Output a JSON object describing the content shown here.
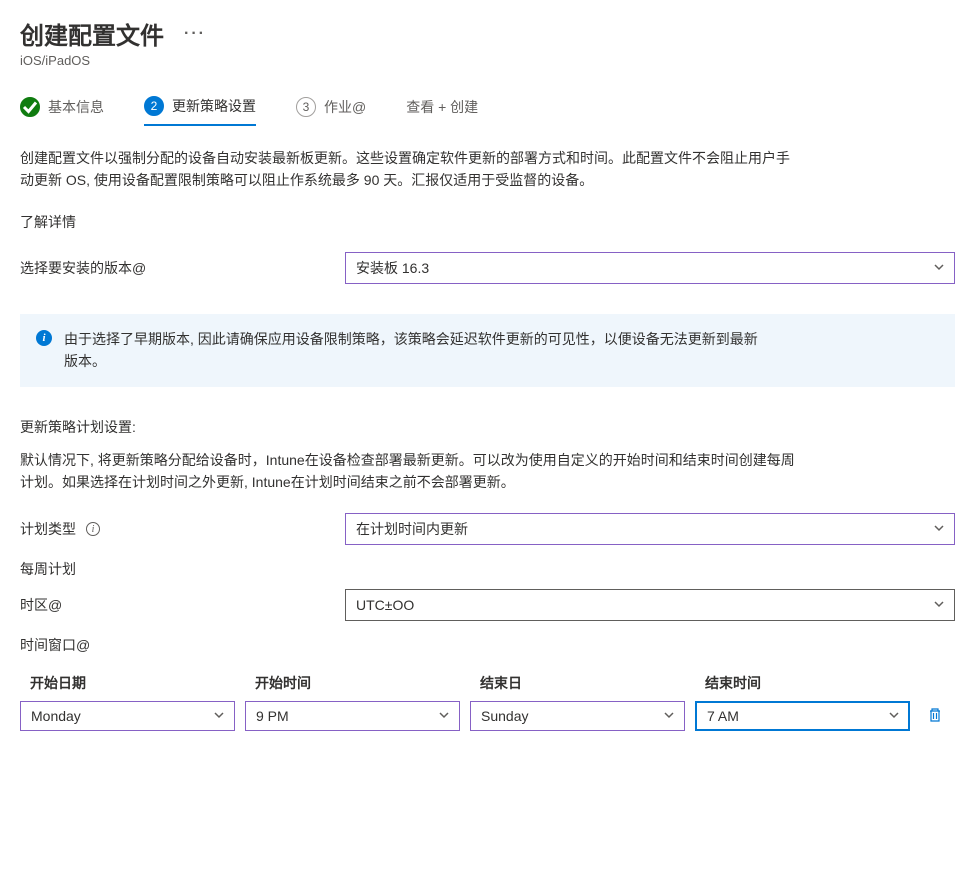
{
  "header": {
    "title": "创建配置文件",
    "more": "···",
    "subtitle": "iOS/iPadOS"
  },
  "stepper": {
    "step1": "基本信息",
    "step2_num": "2",
    "step2": "更新策略设置",
    "step3_num": "3",
    "step3": "作业@",
    "step4": "查看 + 创建"
  },
  "description": "创建配置文件以强制分配的设备自动安装最新板更新。这些设置确定软件更新的部署方式和时间。此配置文件不会阻止用户手动更新 OS, 使用设备配置限制策略可以阻止作系统最多 90 天。汇报仅适用于受监督的设备。",
  "learn_more": "了解详情",
  "version": {
    "label": "选择要安装的版本@",
    "value": "安装板 16.3"
  },
  "banner": "由于选择了早期版本, 因此请确保应用设备限制策略，该策略会延迟软件更新的可见性，以便设备无法更新到最新版本。",
  "schedule": {
    "heading": "更新策略计划设置:",
    "description": "默认情况下, 将更新策略分配给设备时，Intune在设备检查部署最新更新。可以改为使用自定义的开始时间和结束时间创建每周计划。如果选择在计划时间之外更新, Intune在计划时间结束之前不会部署更新。",
    "type_label": "计划类型",
    "type_value": "在计划时间内更新",
    "weekly_label": "每周计划",
    "timezone_label": "时区@",
    "timezone_value": "UTC±OO",
    "window_label": "时间窗口@"
  },
  "table": {
    "headers": {
      "start_day": "开始日期",
      "start_time": "开始时间",
      "end_day": "结束日",
      "end_time": "结束时间"
    },
    "row": {
      "start_day": "Monday",
      "start_time": "9 PM",
      "end_day": "Sunday",
      "end_time": "7 AM"
    }
  }
}
